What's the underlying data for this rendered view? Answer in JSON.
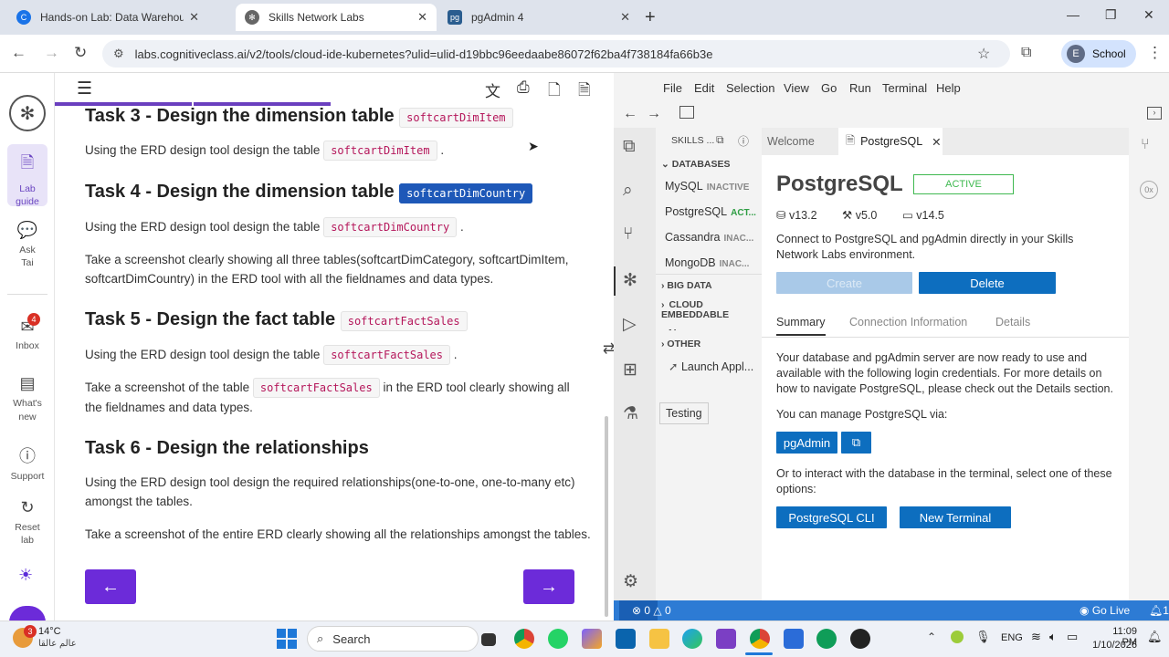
{
  "browser": {
    "tabs": [
      {
        "title": "Hands-on Lab: Data Warehousing",
        "favicon": "C",
        "color": "#1a73e8"
      },
      {
        "title": "Skills Network Labs",
        "favicon": "✻",
        "color": "#555555"
      },
      {
        "title": "pgAdmin 4",
        "favicon": "pg",
        "color": "#2a5d8f"
      }
    ],
    "url": "labs.cognitiveclass.ai/v2/tools/cloud-ide-kubernetes?ulid=ulid-d19bbc96eedaabe86072f62ba4f738184fa66b3e",
    "profile_initial": "E",
    "profile_label": "School"
  },
  "rail": {
    "lab_guide": "Lab guide",
    "ask_tai": "Ask Tai",
    "inbox": "Inbox",
    "inbox_badge": "4",
    "whats_new": "What's new",
    "support": "Support",
    "reset_lab": "Reset lab"
  },
  "instructions": {
    "task3_title": "Task 3 - Design the dimension table",
    "task3_code": "softcartDimItem",
    "task3_p_pre": "Using the ERD design tool design the table",
    "task3_p_code": "softcartDimItem",
    "task3_p_post": ".",
    "task4_title": "Task 4 - Design the dimension table",
    "task4_code": "softcartDimCountry",
    "task4_p_pre": "Using the ERD design tool design the table",
    "task4_p_code": "softcartDimCountry",
    "task4_p_post": ".",
    "task4_shot": "Take a screenshot clearly showing all three tables(softcartDimCategory, softcartDimItem, softcartDimCountry) in the ERD tool with all the fieldnames and data types.",
    "task5_title": "Task 5 - Design the fact table",
    "task5_code": "softcartFactSales",
    "task5_p_pre": "Using the ERD design tool design the table",
    "task5_p_code": "softcartFactSales",
    "task5_p_post": ".",
    "task5_shot_pre": "Take a screenshot of the table",
    "task5_shot_code": "softcartFactSales",
    "task5_shot_post": "in the ERD tool clearly showing all the fieldnames and data types.",
    "task6_title": "Task 6 - Design the relationships",
    "task6_p": "Using the ERD design tool design the required relationships(one-to-one, one-to-many etc) amongst the tables.",
    "task6_shot": "Take a screenshot of the entire ERD clearly showing all the relationships amongst the tables.",
    "prev": "←",
    "next": "→"
  },
  "ide": {
    "menu": [
      "File",
      "Edit",
      "Selection",
      "View",
      "Go",
      "Run",
      "Terminal",
      "Help"
    ],
    "sidebar_title": "SKILLS ...",
    "databases_header": "DATABASES",
    "databases": [
      {
        "name": "MySQL",
        "status": "INACTIVE"
      },
      {
        "name": "PostgreSQL",
        "status": "ACT..."
      },
      {
        "name": "Cassandra",
        "status": "INAC..."
      },
      {
        "name": "MongoDB",
        "status": "INAC..."
      }
    ],
    "big_data": "BIG DATA",
    "cloud": "CLOUD EMBEDDABLE",
    "ai": "AI",
    "other": "OTHER",
    "launch": "Launch Appl...",
    "testing_tooltip": "Testing",
    "tab_welcome": "Welcome",
    "tab_pg": "PostgreSQL",
    "pg_title": "PostgreSQL",
    "pg_status": "ACTIVE",
    "versions": [
      "v13.2",
      "v5.0",
      "v14.5"
    ],
    "pg_desc": "Connect to PostgreSQL and pgAdmin directly in your Skills Network Labs environment.",
    "create": "Create",
    "delete": "Delete",
    "subtabs": [
      "Summary",
      "Connection Information",
      "Details"
    ],
    "summary_p": "Your database and pgAdmin server are now ready to use and available with the following login credentials. For more details on how to navigate PostgreSQL, please check out the Details section.",
    "manage_via": "You can manage PostgreSQL via:",
    "pgadmin_btn": "pgAdmin",
    "terminal_p": "Or to interact with the database in the terminal, select one of these options:",
    "cli_btn": "PostgreSQL CLI",
    "terminal_btn": "New Terminal",
    "status_errors": "⊗ 0 △ 0",
    "go_live": "Go Live",
    "notif": "1",
    "accent": "#0d6ebf"
  },
  "taskbar": {
    "temp": "14°C",
    "weather_sub": "عالم عالقا",
    "weather_badge": "3",
    "search": "Search",
    "lang": "ENG",
    "time": "11:09 PM",
    "date": "1/10/2026"
  }
}
